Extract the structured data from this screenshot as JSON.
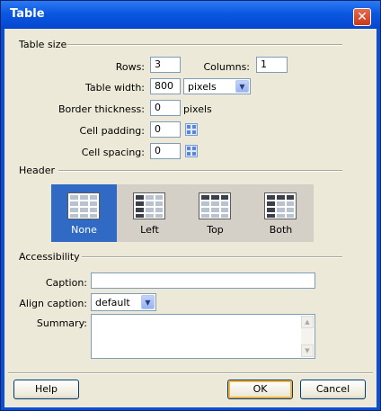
{
  "window": {
    "title": "Table",
    "close_glyph": "✕"
  },
  "sections": {
    "table_size": "Table size",
    "header": "Header",
    "accessibility": "Accessibility"
  },
  "table_size": {
    "rows_label": "Rows:",
    "rows_value": "3",
    "columns_label": "Columns:",
    "columns_value": "1",
    "width_label": "Table width:",
    "width_value": "800",
    "width_unit": "pixels",
    "border_label": "Border thickness:",
    "border_value": "0",
    "border_unit": "pixels",
    "padding_label": "Cell padding:",
    "padding_value": "0",
    "spacing_label": "Cell spacing:",
    "spacing_value": "0"
  },
  "header_options": [
    {
      "label": "None",
      "selected": true
    },
    {
      "label": "Left",
      "selected": false
    },
    {
      "label": "Top",
      "selected": false
    },
    {
      "label": "Both",
      "selected": false
    }
  ],
  "accessibility": {
    "caption_label": "Caption:",
    "caption_value": "",
    "align_label": "Align caption:",
    "align_value": "default",
    "summary_label": "Summary:",
    "summary_value": ""
  },
  "buttons": {
    "help": "Help",
    "ok": "OK",
    "cancel": "Cancel"
  },
  "colors": {
    "titlebar": "#0a58e0",
    "dialog_bg": "#ece9d8",
    "selected": "#316ac5"
  }
}
